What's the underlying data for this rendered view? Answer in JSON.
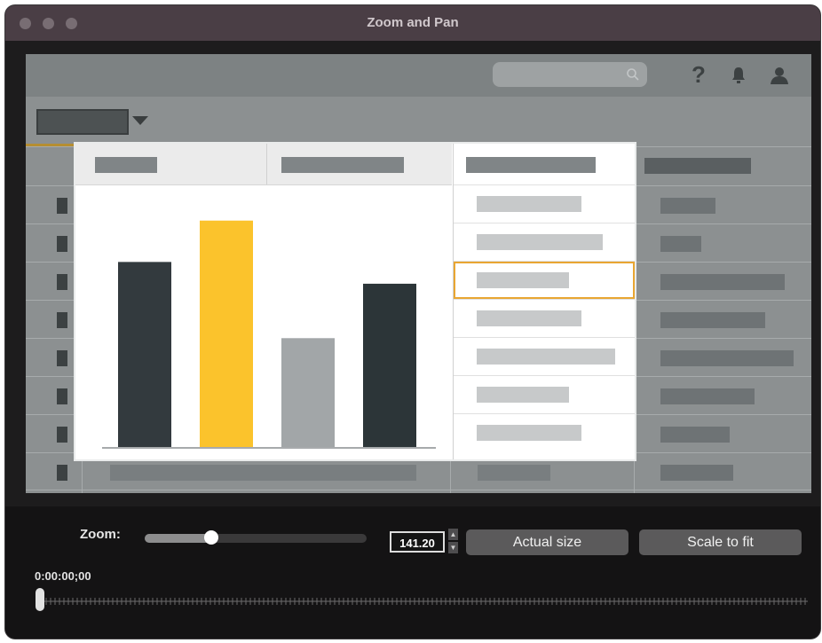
{
  "window": {
    "title": "Zoom and Pan"
  },
  "canvas": {
    "icons": {
      "search": "search-icon",
      "help": "help-icon",
      "notifications": "bell-icon",
      "account": "user-icon"
    },
    "chart_data": {
      "type": "bar",
      "categories": [
        "",
        "",
        "",
        ""
      ],
      "values": [
        85,
        104,
        50,
        75
      ],
      "ylim": [
        0,
        110
      ],
      "bar_colors": [
        "#333a3e",
        "#fbc32c",
        "#a2a6a8",
        "#2c3538"
      ]
    }
  },
  "footer": {
    "zoom_label": "Zoom:",
    "zoom_value": "141.20",
    "zoom_level": 0.3,
    "actual_size_label": "Actual size",
    "scale_to_fit_label": "Scale to fit",
    "timecode": "0:00:00;00"
  },
  "colors": {
    "accent": "#e9a632",
    "titlebar": "#4a3e45",
    "footer": "#141314"
  }
}
